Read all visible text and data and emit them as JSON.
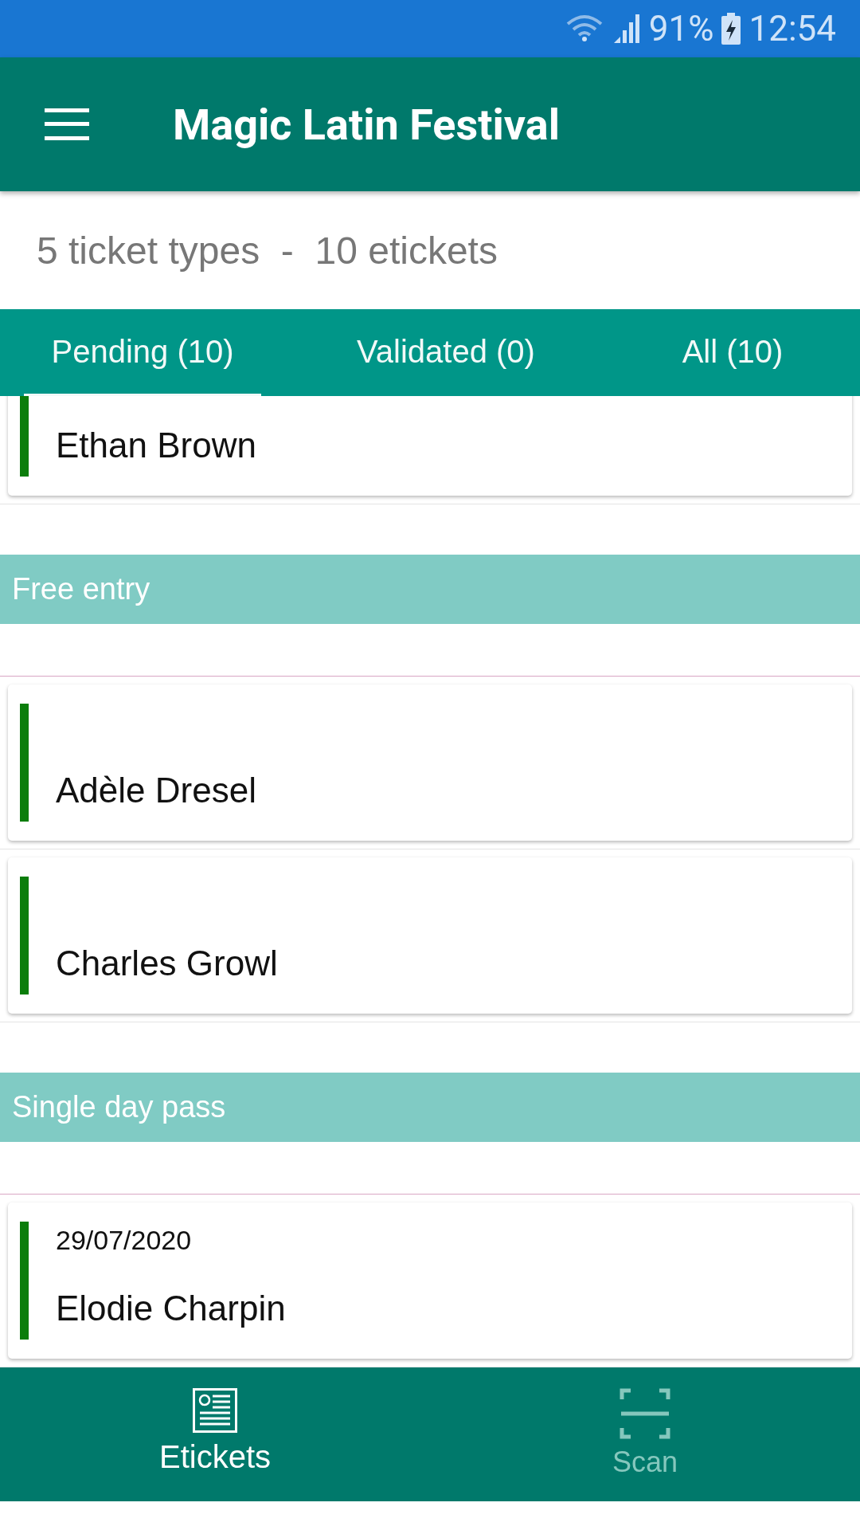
{
  "status_bar": {
    "battery": "91%",
    "time": "12:54"
  },
  "app_bar": {
    "title": "Magic Latin Festival"
  },
  "summary": "5 ticket types  -  10 etickets",
  "tabs": [
    {
      "label": "Pending (10)",
      "selected": true
    },
    {
      "label": "Validated (0)",
      "selected": false
    },
    {
      "label": "All (10)",
      "selected": false
    }
  ],
  "list": [
    {
      "kind": "ticket",
      "name": "Ethan Brown",
      "color": "#0b7d0b"
    },
    {
      "kind": "section",
      "title": "Free entry"
    },
    {
      "kind": "ticket",
      "name": "Adèle Dresel",
      "color": "#0b7d0b"
    },
    {
      "kind": "ticket",
      "name": "Charles Growl",
      "color": "#0b7d0b"
    },
    {
      "kind": "section",
      "title": "Single day pass"
    },
    {
      "kind": "ticket",
      "date": "29/07/2020",
      "name": "Elodie Charpin",
      "color": "#0b7d0b"
    }
  ],
  "bottom_nav": [
    {
      "label": "Etickets",
      "kind": "ticket",
      "selected": true
    },
    {
      "label": "Scan",
      "kind": "scan",
      "selected": false
    }
  ]
}
